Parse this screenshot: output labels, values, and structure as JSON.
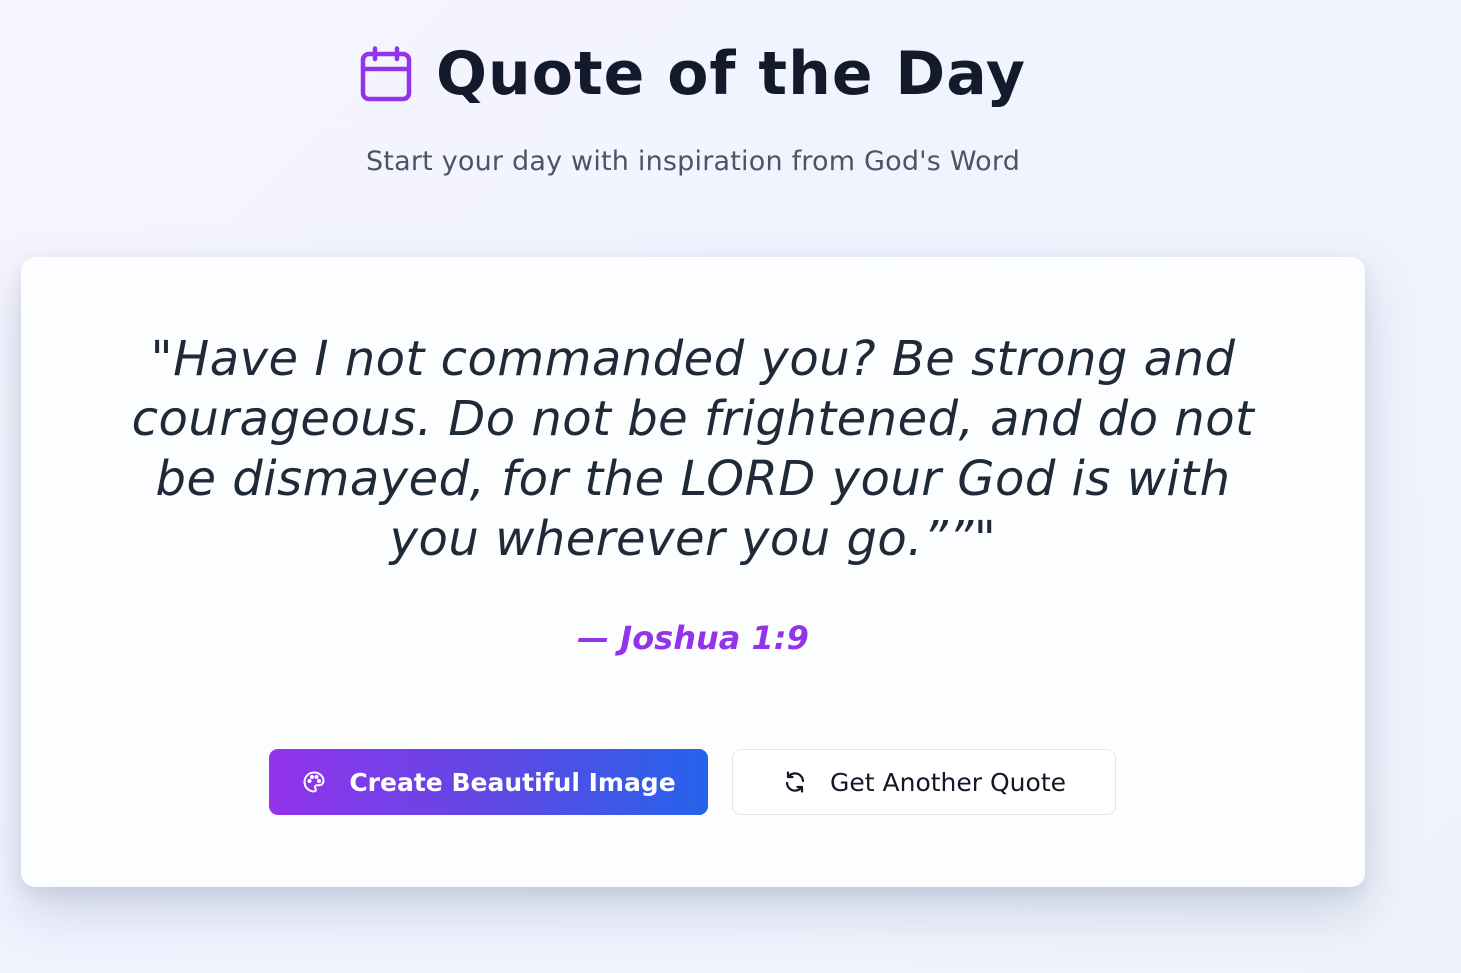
{
  "header": {
    "title": "Quote of the Day",
    "subtitle": "Start your day with inspiration from God's Word",
    "title_icon": "calendar-icon"
  },
  "quote": {
    "text": "\"Have I not commanded you? Be strong and courageous. Do not be frightened, and do not be dismayed, for the LORD your God is with you wherever you go.””\"",
    "reference": "— Joshua 1:9"
  },
  "actions": {
    "create_image_label": "Create Beautiful Image",
    "create_image_icon": "palette-icon",
    "another_quote_label": "Get Another Quote",
    "another_quote_icon": "refresh-icon"
  },
  "colors": {
    "accent_purple": "#9333ea",
    "accent_blue": "#2563eb",
    "title_text": "#131a2b",
    "quote_text": "#1f2937",
    "subtitle_text": "#4b5563"
  }
}
